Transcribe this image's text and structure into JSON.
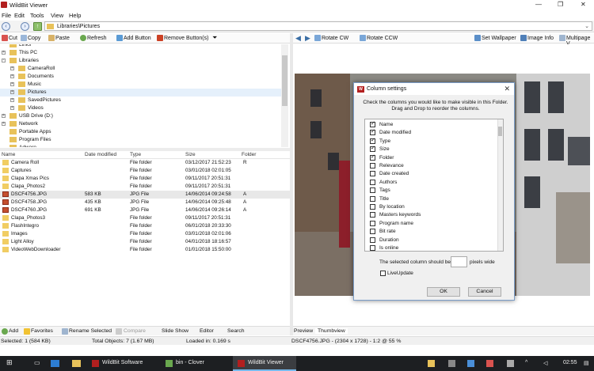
{
  "window": {
    "title": "WildBit Viewer"
  },
  "menu": [
    "File",
    "Edit",
    "Tools",
    "View",
    "Help"
  ],
  "address": {
    "path": "Libraries\\Pictures"
  },
  "toolbar_left": {
    "cut": "Cut",
    "copy": "Copy",
    "paste": "Paste",
    "refresh": "Refresh",
    "add_button": "Add Button",
    "remove_button": "Remove Button(s)"
  },
  "toolbar_right": {
    "rotate_cw": "Rotate CW",
    "rotate_ccw": "Rotate CCW",
    "set_wallpaper": "Set Wallpaper",
    "image_info": "Image Info",
    "multipage": "Multipage V"
  },
  "tree": [
    {
      "label": "Links",
      "indent": 0,
      "exp": ""
    },
    {
      "label": "This PC",
      "indent": 0,
      "exp": "+"
    },
    {
      "label": "Libraries",
      "indent": 0,
      "exp": "-"
    },
    {
      "label": "CameraRoll",
      "indent": 1,
      "exp": "+"
    },
    {
      "label": "Documents",
      "indent": 1,
      "exp": "+"
    },
    {
      "label": "Music",
      "indent": 1,
      "exp": "+"
    },
    {
      "label": "Pictures",
      "indent": 1,
      "exp": "+",
      "selected": true
    },
    {
      "label": "SavedPictures",
      "indent": 1,
      "exp": "+"
    },
    {
      "label": "Videos",
      "indent": 1,
      "exp": "+"
    },
    {
      "label": "USB Drive (D:)",
      "indent": 0,
      "exp": "+"
    },
    {
      "label": "Network",
      "indent": 0,
      "exp": "+"
    },
    {
      "label": "Portable Apps",
      "indent": 0,
      "exp": ""
    },
    {
      "label": "Program Files",
      "indent": 0,
      "exp": ""
    },
    {
      "label": "Adware",
      "indent": 0,
      "exp": ""
    }
  ],
  "list_headers": {
    "name": "Name",
    "date": "Date modified",
    "type": "Type",
    "size": "Size",
    "folder": "Folder"
  },
  "files": [
    {
      "name": "Camera Roll",
      "size": "",
      "type": "File folder",
      "date": "03/12/2017 21:52:23",
      "folder": "R",
      "kind": "folder"
    },
    {
      "name": "Captures",
      "size": "",
      "type": "File folder",
      "date": "03/01/2018 02:01:05",
      "folder": "",
      "kind": "folder"
    },
    {
      "name": "Clapa Xmas Pics",
      "size": "",
      "type": "File folder",
      "date": "09/11/2017 20:51:31",
      "folder": "",
      "kind": "folder"
    },
    {
      "name": "Clapa_Photos2",
      "size": "",
      "type": "File folder",
      "date": "09/11/2017 20:51:31",
      "folder": "",
      "kind": "folder"
    },
    {
      "name": "DSCF4756.JPG",
      "size": "583 KB",
      "type": "JPG File",
      "date": "14/06/2014 09:24:58",
      "folder": "A",
      "kind": "jpg",
      "selected": true
    },
    {
      "name": "DSCF4758.JPG",
      "size": "435 KB",
      "type": "JPG File",
      "date": "14/06/2014 09:25:48",
      "folder": "A",
      "kind": "jpg"
    },
    {
      "name": "DSCF4760.JPG",
      "size": "691 KB",
      "type": "JPG File",
      "date": "14/06/2014 09:26:14",
      "folder": "A",
      "kind": "jpg"
    },
    {
      "name": "Clapa_Photos3",
      "size": "",
      "type": "File folder",
      "date": "09/11/2017 20:51:31",
      "folder": "",
      "kind": "folder"
    },
    {
      "name": "FlashIntegro",
      "size": "",
      "type": "File folder",
      "date": "06/01/2018 20:33:30",
      "folder": "",
      "kind": "folder"
    },
    {
      "name": "Images",
      "size": "",
      "type": "File folder",
      "date": "03/01/2018 02:01:06",
      "folder": "",
      "kind": "folder"
    },
    {
      "name": "Light Alloy",
      "size": "",
      "type": "File folder",
      "date": "04/01/2018 18:16:57",
      "folder": "",
      "kind": "folder"
    },
    {
      "name": "VideoWebDownloader",
      "size": "",
      "type": "File folder",
      "date": "01/01/2018 15:50:00",
      "folder": "",
      "kind": "folder"
    }
  ],
  "bottom_left": {
    "add": "Add",
    "favorites": "Favorites",
    "rename": "Rename Selected",
    "compare": "Compare",
    "slideshow": "Slide Show",
    "editor": "Editor",
    "search": "Search"
  },
  "bottom_right": {
    "preview": "Preview",
    "thumbview": "Thumbview"
  },
  "status": {
    "selected": "Selected: 1 (584 KB)",
    "total": "Total Objects: 7 (1.67 MB)",
    "loaded": "Loaded in: 0.169 s",
    "image": "DSCF4756.JPG - (2304 x 1728) - 1:2 @ 55  %"
  },
  "dialog": {
    "title": "Column settings",
    "description": "Check the columns you would like to make visible in this Folder.  Drag and Drop to reorder the columns.",
    "columns": [
      {
        "label": "Name",
        "checked": true
      },
      {
        "label": "Date modified",
        "checked": true
      },
      {
        "label": "Type",
        "checked": true
      },
      {
        "label": "Size",
        "checked": true
      },
      {
        "label": "Folder",
        "checked": true
      },
      {
        "label": "Relevance",
        "checked": false
      },
      {
        "label": "Date created",
        "checked": false
      },
      {
        "label": "Authors",
        "checked": false
      },
      {
        "label": "Tags",
        "checked": false
      },
      {
        "label": "Title",
        "checked": false
      },
      {
        "label": "By location",
        "checked": false
      },
      {
        "label": "Masters keywords",
        "checked": false
      },
      {
        "label": "Program name",
        "checked": false
      },
      {
        "label": "Bit rate",
        "checked": false
      },
      {
        "label": "Duration",
        "checked": false
      },
      {
        "label": "Is online",
        "checked": false
      }
    ],
    "width_label": "The selected column should be",
    "width_value": "",
    "width_unit": "pixels wide",
    "live_update": "LiveUpdate",
    "ok": "OK",
    "cancel": "Cancel"
  },
  "taskbar": {
    "wildbit_software": "WildBit Software",
    "bin_clover": "bin - Clover",
    "wildbit_viewer": "WildBit Viewer",
    "clock": "02:55"
  }
}
